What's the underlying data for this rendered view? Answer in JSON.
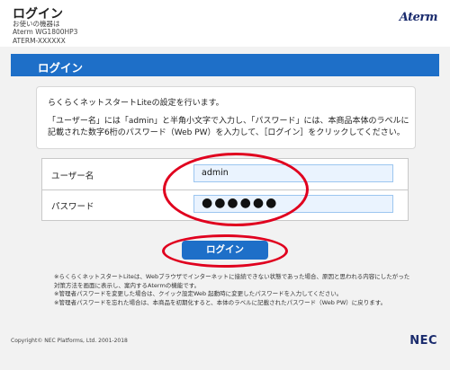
{
  "header": {
    "title": "ログイン",
    "device_label": "お使いの機器は",
    "model": "Aterm WG1800HP3",
    "serial": "ATERM-XXXXXX",
    "brand": "Aterm"
  },
  "main": {
    "section_title": "ログイン",
    "info_line1": "らくらくネットスタートLiteの設定を行います。",
    "info_line2": "「ユーザー名」には「admin」と半角小文字で入力し、「パスワード」には、本商品本体のラベルに記載された数字6桁のパスワード（Web PW）を入力して、［ログイン］をクリックしてください。"
  },
  "form": {
    "username_label": "ユーザー名",
    "username_value": "admin",
    "password_label": "パスワード",
    "password_value": "●●●●●●",
    "login_label": "ログイン"
  },
  "notes": [
    "※らくらくネットスタートLiteは、Webブラウザでインターネットに接続できない状態であった場合、原因と思われる内容にしたがった対策方法を画面に表示し、案内するAtermの機能です。",
    "※管理者パスワードを変更した場合は、クイック設定Web 起動時に変更したパスワードを入力してください。",
    "※管理者パスワードを忘れた場合は、本商品を初期化すると、本体のラベルに記載されたパスワード（Web PW）に戻ります。"
  ],
  "footer": {
    "copyright": "Copyright© NEC Platforms, Ltd. 2001-2018",
    "brand": "NEC"
  },
  "colors": {
    "accent": "#1e6fc8",
    "highlight": "#e0001e",
    "input_bg": "#eaf3fe"
  }
}
